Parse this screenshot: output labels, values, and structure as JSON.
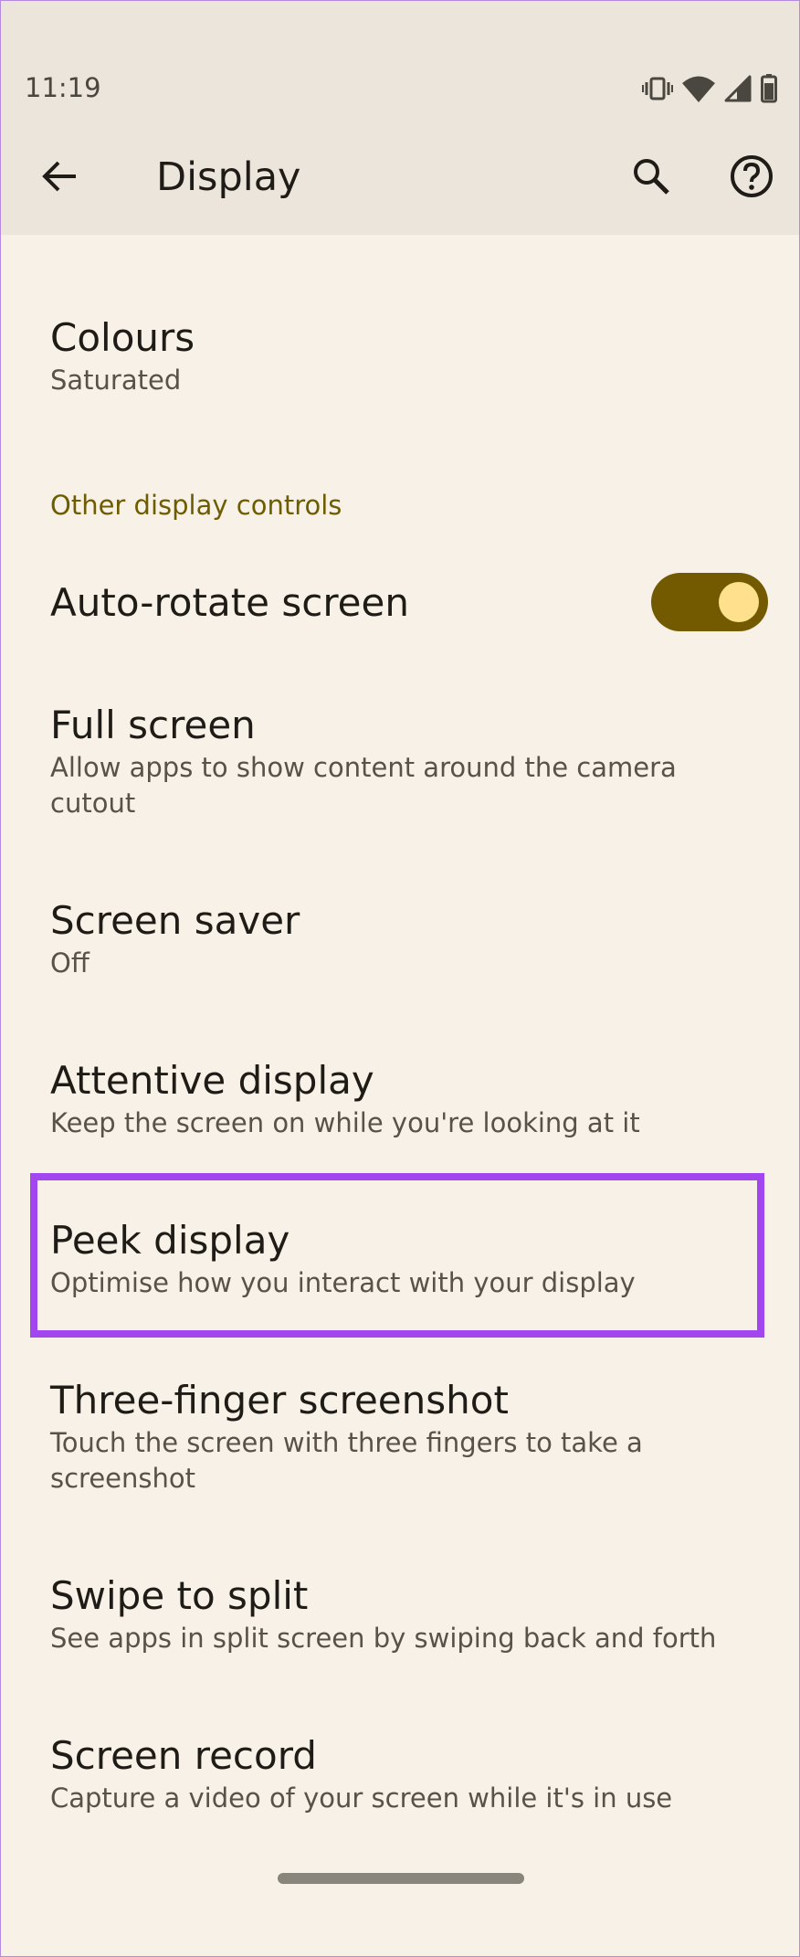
{
  "status_bar": {
    "time": "11:19",
    "icons": [
      "vibrate-icon",
      "wifi-icon",
      "signal-icon",
      "battery-icon"
    ]
  },
  "app_bar": {
    "title": "Display",
    "back_icon": "back-arrow-icon",
    "actions": [
      "search-icon",
      "help-icon"
    ]
  },
  "list": {
    "colours": {
      "title": "Colours",
      "summary": "Saturated"
    },
    "section_header": "Other display controls",
    "auto_rotate": {
      "title": "Auto-rotate screen",
      "checked": true
    },
    "full_screen": {
      "title": "Full screen",
      "summary": "Allow apps to show content around the camera cutout"
    },
    "screen_saver": {
      "title": "Screen saver",
      "summary": "Off"
    },
    "attentive_display": {
      "title": "Attentive display",
      "summary": "Keep the screen on while you're looking at it"
    },
    "peek_display": {
      "title": "Peek display",
      "summary": "Optimise how you interact with your display"
    },
    "three_finger": {
      "title": "Three-finger screenshot",
      "summary": "Touch the screen with three fingers to take a screenshot"
    },
    "swipe_split": {
      "title": "Swipe to split",
      "summary": "See apps in split screen by swiping back and forth"
    },
    "screen_record": {
      "title": "Screen record",
      "summary": "Capture a video of your screen while it's in use"
    }
  },
  "colors": {
    "background": "#f7f1e7",
    "app_bar": "#ebe5dc",
    "accent_text": "#6e5c00",
    "toggle_track": "#735a00",
    "toggle_thumb": "#ffe08c",
    "highlight_border": "#a246f0"
  }
}
